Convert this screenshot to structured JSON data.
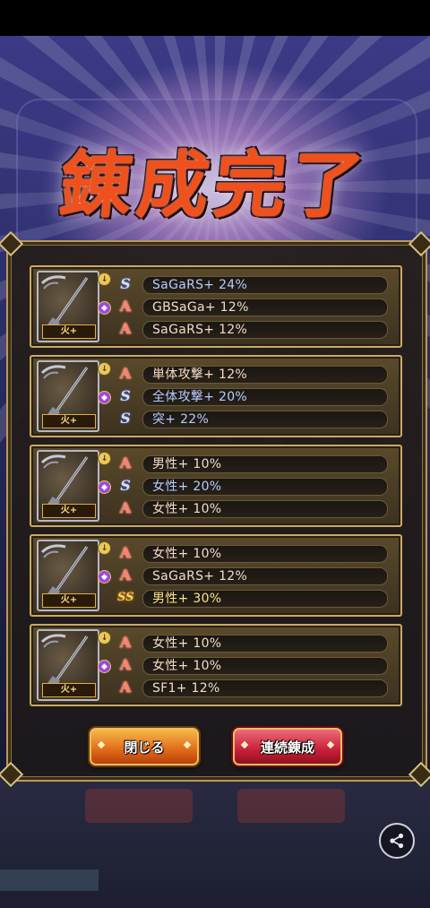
{
  "title": "錬成完了",
  "cards": [
    {
      "weapon_tag": "火+",
      "stats": [
        {
          "rank": "S",
          "text": "SaGaRS+ 24%"
        },
        {
          "rank": "A",
          "text": "GBSaGa+ 12%"
        },
        {
          "rank": "A",
          "text": "SaGaRS+ 12%"
        }
      ]
    },
    {
      "weapon_tag": "火+",
      "stats": [
        {
          "rank": "A",
          "text": "単体攻撃+ 12%"
        },
        {
          "rank": "S",
          "text": "全体攻撃+ 20%"
        },
        {
          "rank": "S",
          "text": "突+ 22%"
        }
      ]
    },
    {
      "weapon_tag": "火+",
      "stats": [
        {
          "rank": "A",
          "text": "男性+ 10%"
        },
        {
          "rank": "S",
          "text": "女性+ 20%"
        },
        {
          "rank": "A",
          "text": "女性+ 10%"
        }
      ]
    },
    {
      "weapon_tag": "火+",
      "stats": [
        {
          "rank": "A",
          "text": "女性+ 10%"
        },
        {
          "rank": "A",
          "text": "SaGaRS+ 12%"
        },
        {
          "rank": "SS",
          "text": "男性+ 30%"
        }
      ]
    },
    {
      "weapon_tag": "火+",
      "stats": [
        {
          "rank": "A",
          "text": "女性+ 10%"
        },
        {
          "rank": "A",
          "text": "女性+ 10%"
        },
        {
          "rank": "A",
          "text": "SF1+ 12%"
        }
      ]
    }
  ],
  "buttons": {
    "close_label": "閉じる",
    "continue_label": "連続錬成"
  },
  "rank_glyphs": {
    "A": "A",
    "S": "S",
    "SS": "SS"
  },
  "icons": {
    "share": "share-icon",
    "weapon": "spear-icon"
  },
  "colors": {
    "rank_A": "#ff8066",
    "rank_S": "#b8ccff",
    "rank_SS": "#ffe48c",
    "close_button": "#e06a18",
    "continue_button": "#c8203a",
    "frame_gold": "#c8aa62"
  }
}
